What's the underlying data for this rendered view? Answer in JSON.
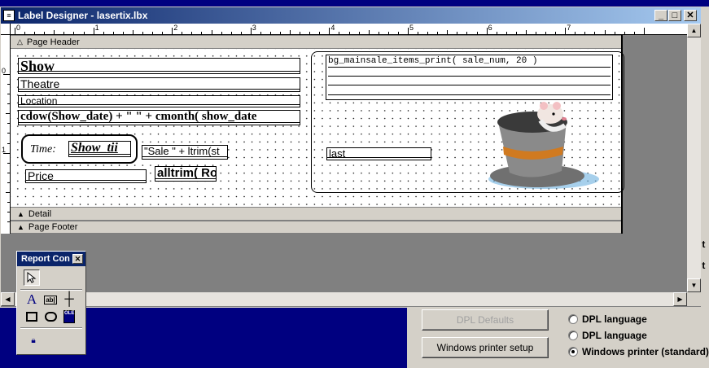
{
  "window": {
    "title": "Label Designer - lasertix.lbx",
    "icon": "document-icon"
  },
  "ruler": {
    "numbers": [
      "0",
      "1",
      "2",
      "3",
      "4",
      "5",
      "6",
      "7"
    ],
    "vnumbers": [
      "0",
      "1"
    ]
  },
  "bands": {
    "header": "Page Header",
    "detail": "Detail",
    "footer": "Page Footer"
  },
  "fields": {
    "show": "Show",
    "theatre": "Theatre",
    "location": "Location",
    "date_expr": "cdow(Show_date) + \" \" + cmonth( show_date",
    "time_label": "Time:",
    "time_field": "Show_tii",
    "sale_expr": "\"Sale \" + ltrim(st",
    "price": "Price",
    "price_expr": "alltrim( Ro",
    "items_print": "bg_mainsale_items_print( sale_num, 20 )",
    "last": "last"
  },
  "image": {
    "name": "mouse-in-hat-icon"
  },
  "toolbox": {
    "title": "Report Con",
    "tools": [
      "pointer-icon",
      "label-tool-icon",
      "field-tool-icon",
      "line-tool-icon",
      "rectangle-tool-icon",
      "rounded-rect-tool-icon",
      "picture-ole-tool-icon",
      "lock-icon"
    ]
  },
  "background_dialog": {
    "disabled_button": "DPL Defaults",
    "printer_setup_button": "Windows printer setup",
    "radio_partial": "DPL language",
    "radio_dpl": "DPL language",
    "radio_windows": "Windows printer (standard)",
    "partial_n1": "nt",
    "partial_n2": "nt"
  }
}
